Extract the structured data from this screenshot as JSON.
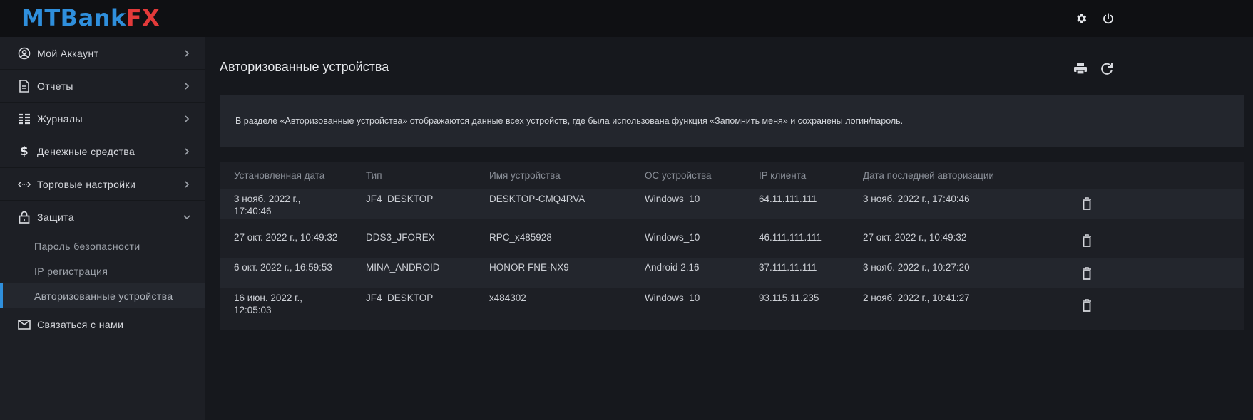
{
  "app": {
    "logo_main": "MTBank",
    "logo_accent": "FX",
    "logo_color": "#2f8fdc",
    "logo_accent_color": "#e23a3a"
  },
  "topbar": {
    "icons": [
      "gear-icon",
      "power-icon"
    ]
  },
  "sidebar": {
    "items": [
      {
        "icon": "user-circle-icon",
        "label": "Мой Аккаунт"
      },
      {
        "icon": "document-icon",
        "label": "Отчеты"
      },
      {
        "icon": "journal-icon",
        "label": "Журналы"
      },
      {
        "icon": "dollar-icon",
        "label": "Денежные средства"
      },
      {
        "icon": "code-arrows-icon",
        "label": "Торговые настройки"
      },
      {
        "icon": "lock-icon",
        "label": "Защита",
        "expanded": true
      }
    ],
    "sub_items": [
      {
        "label": "Пароль безопасности"
      },
      {
        "label": "IP регистрация"
      },
      {
        "label": "Авторизованные устройства",
        "active": true
      }
    ],
    "contact": {
      "icon": "envelope-icon",
      "label": "Связаться с нами"
    }
  },
  "main": {
    "title": "Авторизованные устройства",
    "icons": [
      "printer-icon",
      "refresh-icon"
    ],
    "info": "В разделе «Авторизованные устройства» отображаются данные всех устройств, где была использована функция «Запомнить меня» и сохранены логин/пароль."
  },
  "table": {
    "headers": [
      "Установленная дата",
      "Тип",
      "Имя устройства",
      "ОС устройства",
      "IP клиента",
      "Дата последней авторизации"
    ],
    "rows": [
      {
        "installed_1": "3 нояб. 2022 г.,",
        "installed_2": "17:40:46",
        "type": "JF4_DESKTOP",
        "device": "DESKTOP-CMQ4RVA",
        "os": "Windows_10",
        "ip": "64.11.111.111",
        "last_auth": "3 нояб. 2022 г., 17:40:46"
      },
      {
        "installed_1": "27 окт. 2022 г., 10:49:32",
        "installed_2": "",
        "type": "DDS3_JFOREX",
        "device": "RPC_x485928",
        "os": "Windows_10",
        "ip": "46.111.111.111",
        "last_auth": "27 окт. 2022 г., 10:49:32"
      },
      {
        "installed_1": "6 окт. 2022 г., 16:59:53",
        "installed_2": "",
        "type": "MINA_ANDROID",
        "device": "HONOR FNE-NX9",
        "os": "Android 2.16",
        "ip": "37.111.11.111",
        "last_auth": "3 нояб. 2022 г., 10:27:20"
      },
      {
        "installed_1": "16 июн. 2022 г.,",
        "installed_2": "12:05:03",
        "type": "JF4_DESKTOP",
        "device": "x484302",
        "os": "Windows_10",
        "ip": "93.115.11.235",
        "last_auth": "2 нояб. 2022 г., 10:41:27"
      }
    ],
    "row_action_icon": "trash-icon"
  }
}
